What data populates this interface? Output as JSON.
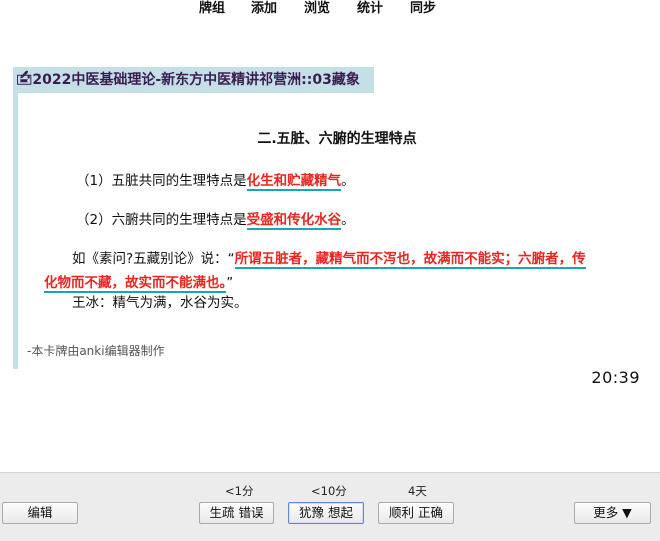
{
  "toolbar": {
    "items": [
      "牌组",
      "添加",
      "浏览",
      "统计",
      "同步"
    ]
  },
  "card": {
    "deck_title": "🖆2022中医基础理论-新东方中医精讲祁营洲::03藏象",
    "section_heading": "二.五脏、六腑的生理特点",
    "line1": {
      "prefix": "（1）五脏共同的生理特点是",
      "answer": "化生和贮藏精气",
      "suffix": "。"
    },
    "line2": {
      "prefix": "（2）六腑共同的生理特点是",
      "answer": "受盛和传化水谷",
      "suffix": "。"
    },
    "line3": {
      "prefix": "如《素问?五藏别论》说：“",
      "answer_part1": "所谓五脏者，藏精气而不泻也，故满而不能实；六腑者，传",
      "answer_part2": "化物而不藏，故实而不能满也。",
      "suffix": "”"
    },
    "line4": "王冰：精气为满，水谷为实。",
    "footer_note": "-本卡牌由anki编辑器制作",
    "clock": "20:39"
  },
  "review": {
    "intervals": [
      "<1分",
      "<10分",
      "4天"
    ],
    "edit_label": "编辑",
    "again_label": "生疏 错误",
    "hard_label": "犹豫 想起",
    "good_label": "顺利 正确",
    "more_label": "更多 ▼"
  },
  "colors": {
    "deck_bar": "#c4e0e6",
    "answer_text": "#e8251f",
    "answer_underline": "#1aa6b0"
  }
}
